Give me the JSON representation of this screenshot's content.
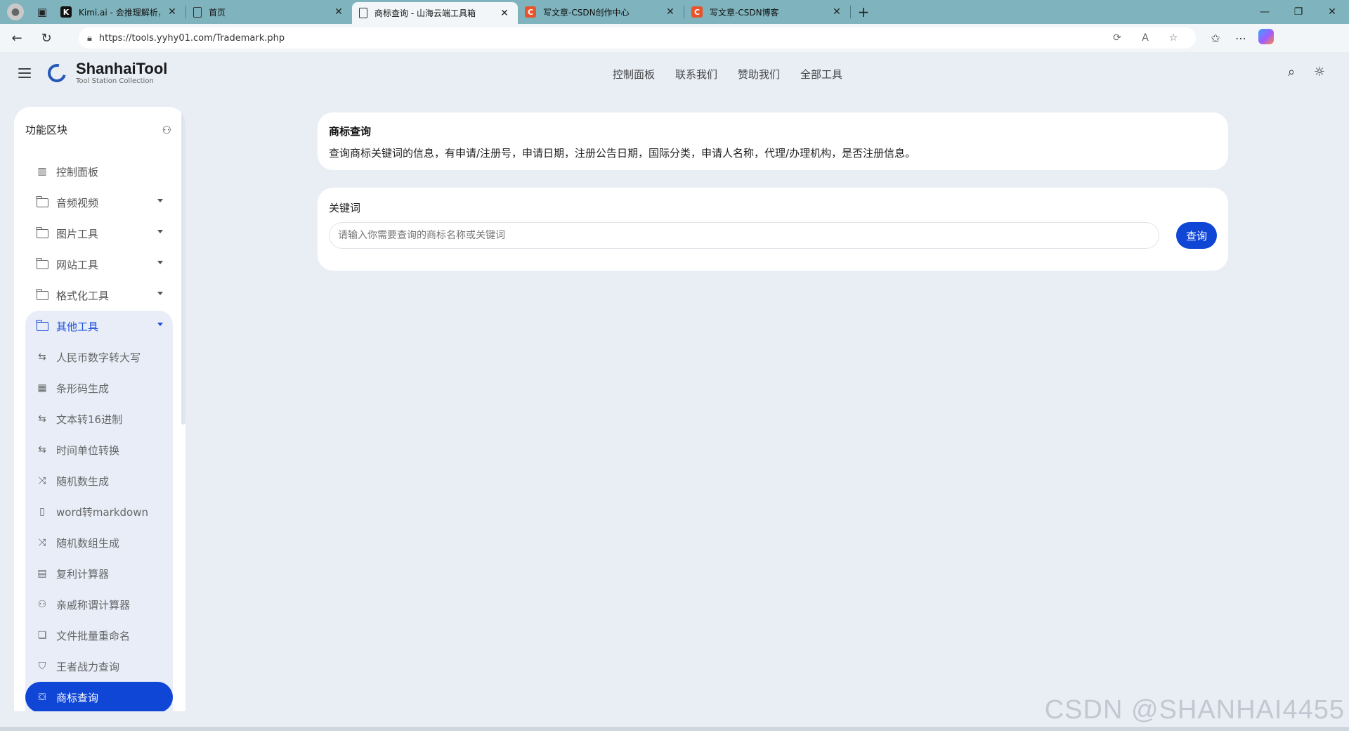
{
  "browser": {
    "tabs": [
      {
        "title": "Kimi.ai - 会推理解析，能深度思考",
        "favicon": "k-icon",
        "active": false
      },
      {
        "title": "首页",
        "favicon": "page-icon",
        "active": false
      },
      {
        "title": "商标查询 - 山海云端工具箱",
        "favicon": "page-icon",
        "active": true
      },
      {
        "title": "写文章-CSDN创作中心",
        "favicon": "csdn-icon",
        "active": false
      },
      {
        "title": "写文章-CSDN博客",
        "favicon": "csdn-icon",
        "active": false
      }
    ],
    "url": "https://tools.yyhy01.com/Trademark.php",
    "csdn_letter": "C",
    "kimi_letter": "K"
  },
  "header": {
    "logo_name": "Shanhai",
    "logo_name_bold": "Tool",
    "logo_sub": "Tool Station Collection",
    "nav": [
      "控制面板",
      "联系我们",
      "赞助我们",
      "全部工具"
    ]
  },
  "sidebar": {
    "title": "功能区块",
    "items": [
      {
        "label": "控制面板",
        "icon": "dashboard-icon"
      },
      {
        "label": "音频视频",
        "icon": "folder-icon"
      },
      {
        "label": "图片工具",
        "icon": "folder-icon"
      },
      {
        "label": "网站工具",
        "icon": "folder-icon"
      },
      {
        "label": "格式化工具",
        "icon": "folder-icon"
      }
    ],
    "group": {
      "label": "其他工具",
      "children": [
        {
          "label": "人民币数字转大写",
          "icon": "swap-icon"
        },
        {
          "label": "条形码生成",
          "icon": "barcode-icon"
        },
        {
          "label": "文本转16进制",
          "icon": "swap-icon"
        },
        {
          "label": "时间单位转换",
          "icon": "swap-icon"
        },
        {
          "label": "随机数生成",
          "icon": "shuffle-icon"
        },
        {
          "label": "word转markdown",
          "icon": "word-file-icon"
        },
        {
          "label": "随机数组生成",
          "icon": "shuffle-icon"
        },
        {
          "label": "复利计算器",
          "icon": "table-icon"
        },
        {
          "label": "亲戚称谓计算器",
          "icon": "users-icon"
        },
        {
          "label": "文件批量重命名",
          "icon": "copy-icon"
        },
        {
          "label": "王者战力查询",
          "icon": "shield-icon"
        },
        {
          "label": "商标查询",
          "icon": "bookmark-icon",
          "active": true
        }
      ]
    }
  },
  "main": {
    "info_title": "商标查询",
    "info_desc": "查询商标关键词的信息，有申请/注册号，申请日期，注册公告日期，国际分类，申请人名称，代理/办理机构，是否注册信息。",
    "keyword_label": "关键词",
    "keyword_placeholder": "请输入你需要查询的商标名称或关键词",
    "keyword_value": "",
    "search_button": "查询"
  },
  "watermark": "CSDN @SHANHAI4455",
  "colors": {
    "accent": "#0f46d6",
    "tabbar": "#7fb3bd",
    "background": "#e9eef5"
  }
}
